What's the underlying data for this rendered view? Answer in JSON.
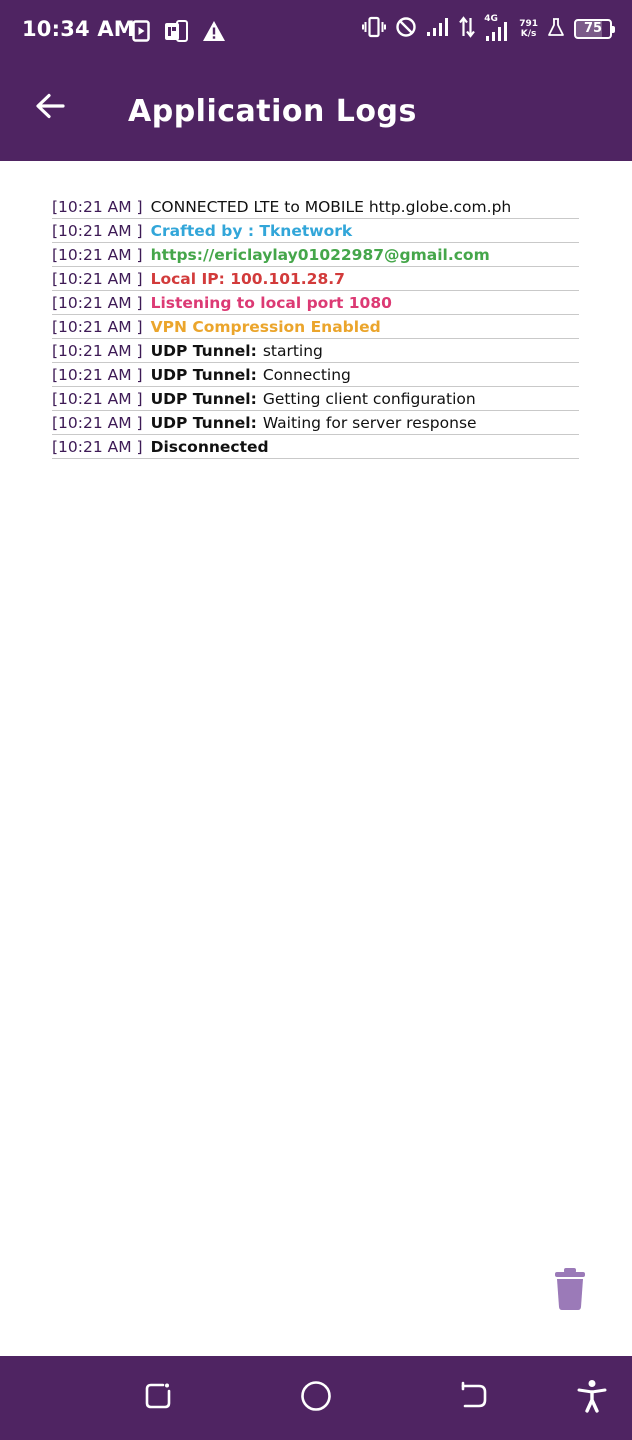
{
  "status_bar": {
    "time": "10:34 AM",
    "net_speed_value": "791",
    "net_speed_unit": "K/s",
    "network_type": "4G",
    "battery": "75"
  },
  "app_bar": {
    "title": "Application Logs"
  },
  "logs": [
    {
      "time": "[10:21 AM ]",
      "label": "",
      "text": "CONNECTED LTE to MOBILE http.globe.com.ph",
      "color": "#111111"
    },
    {
      "time": "[10:21 AM ]",
      "label": "",
      "text": "Crafted by : Tknetwork",
      "color": "#32a6d9"
    },
    {
      "time": "[10:21 AM ]",
      "label": "",
      "text": "https://ericlaylay01022987@gmail.com",
      "color": "#45a64a"
    },
    {
      "time": "[10:21 AM ]",
      "label": "",
      "text": "Local IP: 100.101.28.7",
      "color": "#d23b3b"
    },
    {
      "time": "[10:21 AM ]",
      "label": "",
      "text": "Listening to local port 1080",
      "color": "#dc3a74"
    },
    {
      "time": "[10:21 AM ]",
      "label": "",
      "text": "VPN Compression Enabled",
      "color": "#eba52c"
    },
    {
      "time": "[10:21 AM ]",
      "label": "UDP Tunnel:",
      "text": "starting",
      "color": "#111111"
    },
    {
      "time": "[10:21 AM ]",
      "label": "UDP Tunnel:",
      "text": "Connecting",
      "color": "#111111"
    },
    {
      "time": "[10:21 AM ]",
      "label": "UDP Tunnel:",
      "text": "Getting client configuration",
      "color": "#111111"
    },
    {
      "time": "[10:21 AM ]",
      "label": "UDP Tunnel:",
      "text": "Waiting for server response",
      "color": "#111111"
    },
    {
      "time": "[10:21 AM ]",
      "label": "",
      "text": "Disconnected",
      "color": "#111111"
    }
  ],
  "colors": {
    "primary": "#4f2462",
    "trash": "#9b7ab8",
    "timestamp": "#3d1a55"
  },
  "icons": {
    "back": "arrow-left-icon",
    "delete": "trash-icon",
    "nav_recents": "recents-icon",
    "nav_home": "home-circle-icon",
    "nav_back": "nav-back-icon",
    "accessibility": "accessibility-icon"
  }
}
